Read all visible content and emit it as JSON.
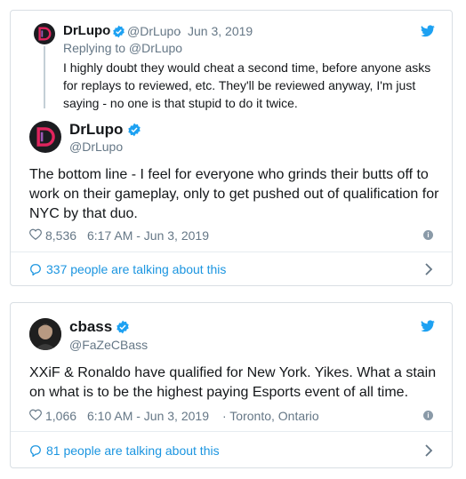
{
  "tweet1": {
    "quoted": {
      "name": "DrLupo",
      "handle": "@DrLupo",
      "sep": "·",
      "date": "Jun 3, 2019",
      "replying_to": "Replying to @DrLupo",
      "text": "I highly doubt they would cheat a second time, before anyone asks for replays to reviewed, etc. They'll be reviewed anyway, I'm just saying - no one is that stupid to do it twice."
    },
    "name": "DrLupo",
    "handle": "@DrLupo",
    "text": "The bottom line - I feel for everyone who grinds their butts off to work on their gameplay, only to get pushed out of qualification for NYC by that duo.",
    "likes": "8,536",
    "timestamp": "6:17 AM - Jun 3, 2019",
    "talking": "337 people are talking about this"
  },
  "tweet2": {
    "name": "cbass",
    "handle": "@FaZeCBass",
    "text": "XXiF & Ronaldo have qualified for New York. Yikes. What a stain on what is to be the highest paying Esports event of all time.",
    "likes": "1,066",
    "timestamp": "6:10 AM - Jun 3, 2019",
    "location": "· Toronto, Ontario",
    "talking": "81 people are talking about this"
  },
  "colors": {
    "twitter_blue": "#1da1f2",
    "link_blue": "#1b95e0",
    "muted": "#657786",
    "border": "#d9dfe4"
  },
  "icons": [
    "twitter-bird-icon",
    "verified-badge-icon",
    "heart-icon",
    "info-icon",
    "comment-icon",
    "chevron-right-icon"
  ]
}
